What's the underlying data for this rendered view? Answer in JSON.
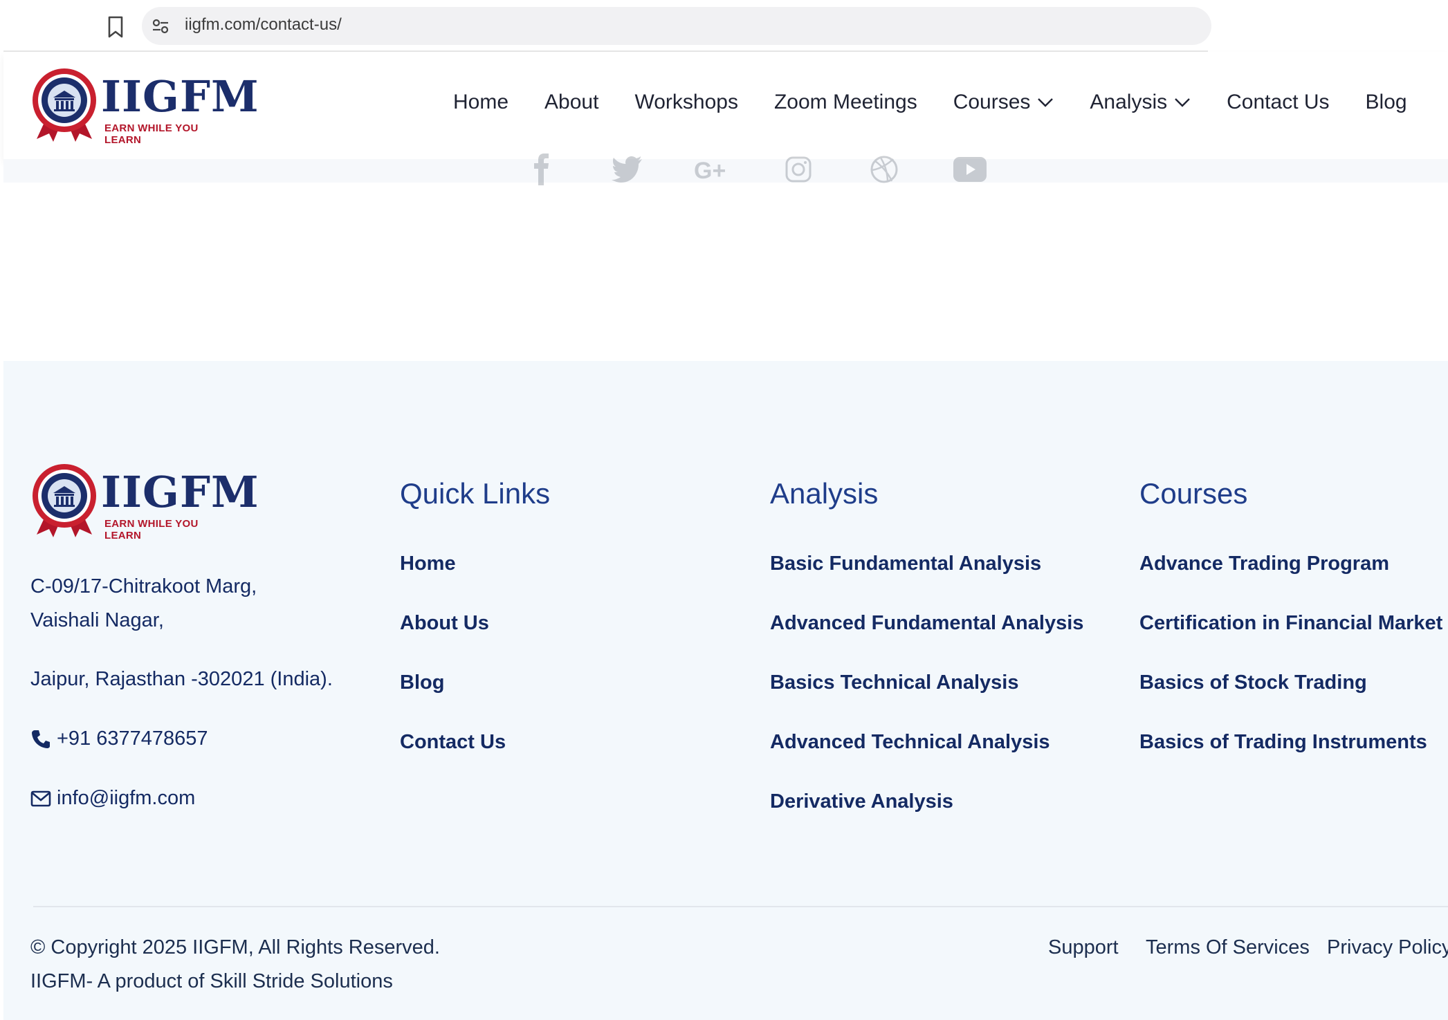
{
  "browser": {
    "url": "iigfm.com/contact-us/"
  },
  "brand": {
    "name": "IIGFM",
    "tagline": "EARN WHILE YOU LEARN",
    "primary_color": "#1c2e6b",
    "accent_color": "#b3162a"
  },
  "nav": {
    "items": [
      {
        "label": "Home"
      },
      {
        "label": "About"
      },
      {
        "label": "Workshops"
      },
      {
        "label": "Zoom Meetings"
      },
      {
        "label": "Courses",
        "dropdown": true
      },
      {
        "label": "Analysis",
        "dropdown": true
      },
      {
        "label": "Contact Us"
      },
      {
        "label": "Blog"
      }
    ]
  },
  "social": {
    "icons": [
      "facebook-icon",
      "twitter-icon",
      "google-plus-icon",
      "instagram-icon",
      "dribbble-icon",
      "youtube-icon"
    ]
  },
  "footer": {
    "address_line1": "C-09/17-Chitrakoot Marg,",
    "address_line2": "Vaishali Nagar,",
    "address_line3": "Jaipur, Rajasthan -302021 (India).",
    "phone": "+91 6377478657",
    "email": "info@iigfm.com",
    "quick_links": {
      "title": "Quick Links",
      "items": [
        "Home",
        "About Us",
        "Blog",
        "Contact Us"
      ]
    },
    "analysis": {
      "title": "Analysis",
      "items": [
        "Basic Fundamental Analysis",
        "Advanced Fundamental Analysis",
        "Basics Technical Analysis",
        "Advanced Technical Analysis",
        "Derivative Analysis"
      ]
    },
    "courses": {
      "title": "Courses",
      "items": [
        "Advance Trading Program",
        "Certification in Financial Market",
        "Basics of Stock Trading",
        "Basics of Trading Instruments"
      ]
    },
    "copyright": "© Copyright 2025 IIGFM, All Rights Reserved.",
    "product_note": "IIGFM- A product of Skill Stride Solutions",
    "legal": {
      "support": "Support",
      "terms": "Terms Of Services",
      "privacy": "Privacy Policy"
    }
  }
}
